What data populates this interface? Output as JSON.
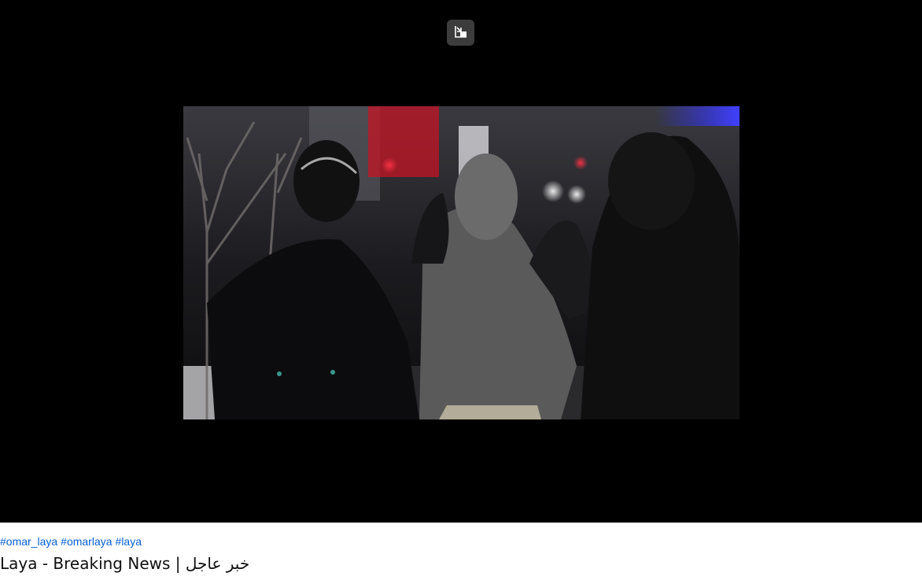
{
  "player": {
    "pip_exit_icon": "exit-picture-in-picture-icon",
    "background_color": "#000000"
  },
  "video": {
    "thumbnail_description_icon": "video-still-frame"
  },
  "metadata": {
    "hashtags": [
      "#omar_laya",
      "#omarlaya",
      "#laya"
    ],
    "title": "Laya - Breaking News | خبر عاجل",
    "hashtag_color": "#065fd4",
    "title_color": "#0f0f0f"
  }
}
